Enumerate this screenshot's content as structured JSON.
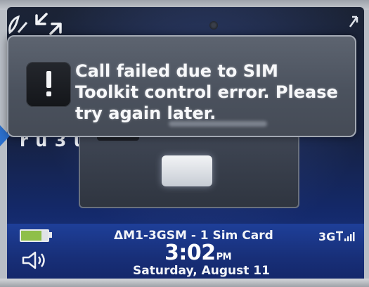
{
  "dialog": {
    "message": "Call failed due to SIM Toolkit control error. Please try again later.",
    "icon": "exclamation-icon"
  },
  "background": {
    "partial_text": "r u 3 u r"
  },
  "statusbar": {
    "carrier": "ΔM1-3GSM - 1 Sim Card",
    "time": "3:02",
    "ampm": "PM",
    "date": "Saturday, August 11",
    "network": "3G",
    "battery_level": 0.75,
    "signal_bars": 4
  },
  "colors": {
    "accent": "#1e3f99",
    "dialog": "#4b525e",
    "battery_fill": "#8fbf4a"
  }
}
